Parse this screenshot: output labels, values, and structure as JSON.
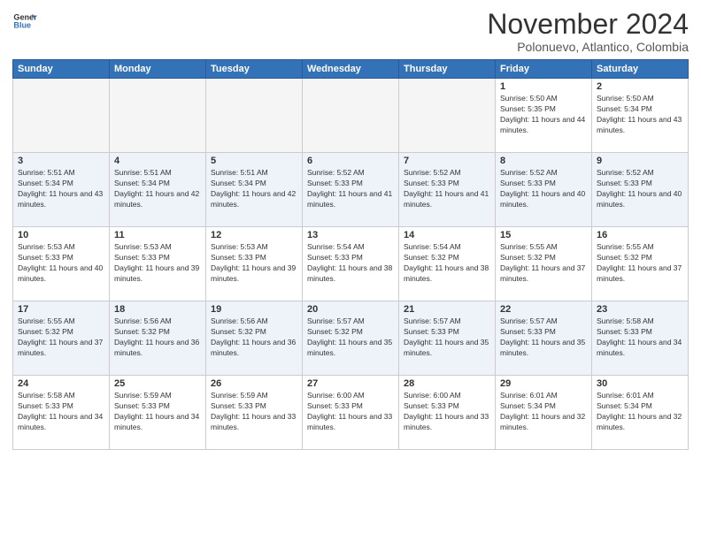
{
  "header": {
    "logo_line1": "General",
    "logo_line2": "Blue",
    "month_title": "November 2024",
    "location": "Polonuevo, Atlantico, Colombia"
  },
  "weekdays": [
    "Sunday",
    "Monday",
    "Tuesday",
    "Wednesday",
    "Thursday",
    "Friday",
    "Saturday"
  ],
  "weeks": [
    [
      {
        "day": "",
        "empty": true
      },
      {
        "day": "",
        "empty": true
      },
      {
        "day": "",
        "empty": true
      },
      {
        "day": "",
        "empty": true
      },
      {
        "day": "",
        "empty": true
      },
      {
        "day": "1",
        "sunrise": "5:50 AM",
        "sunset": "5:35 PM",
        "daylight": "11 hours and 44 minutes."
      },
      {
        "day": "2",
        "sunrise": "5:50 AM",
        "sunset": "5:34 PM",
        "daylight": "11 hours and 43 minutes."
      }
    ],
    [
      {
        "day": "3",
        "sunrise": "5:51 AM",
        "sunset": "5:34 PM",
        "daylight": "11 hours and 43 minutes."
      },
      {
        "day": "4",
        "sunrise": "5:51 AM",
        "sunset": "5:34 PM",
        "daylight": "11 hours and 42 minutes."
      },
      {
        "day": "5",
        "sunrise": "5:51 AM",
        "sunset": "5:34 PM",
        "daylight": "11 hours and 42 minutes."
      },
      {
        "day": "6",
        "sunrise": "5:52 AM",
        "sunset": "5:33 PM",
        "daylight": "11 hours and 41 minutes."
      },
      {
        "day": "7",
        "sunrise": "5:52 AM",
        "sunset": "5:33 PM",
        "daylight": "11 hours and 41 minutes."
      },
      {
        "day": "8",
        "sunrise": "5:52 AM",
        "sunset": "5:33 PM",
        "daylight": "11 hours and 40 minutes."
      },
      {
        "day": "9",
        "sunrise": "5:52 AM",
        "sunset": "5:33 PM",
        "daylight": "11 hours and 40 minutes."
      }
    ],
    [
      {
        "day": "10",
        "sunrise": "5:53 AM",
        "sunset": "5:33 PM",
        "daylight": "11 hours and 40 minutes."
      },
      {
        "day": "11",
        "sunrise": "5:53 AM",
        "sunset": "5:33 PM",
        "daylight": "11 hours and 39 minutes."
      },
      {
        "day": "12",
        "sunrise": "5:53 AM",
        "sunset": "5:33 PM",
        "daylight": "11 hours and 39 minutes."
      },
      {
        "day": "13",
        "sunrise": "5:54 AM",
        "sunset": "5:33 PM",
        "daylight": "11 hours and 38 minutes."
      },
      {
        "day": "14",
        "sunrise": "5:54 AM",
        "sunset": "5:32 PM",
        "daylight": "11 hours and 38 minutes."
      },
      {
        "day": "15",
        "sunrise": "5:55 AM",
        "sunset": "5:32 PM",
        "daylight": "11 hours and 37 minutes."
      },
      {
        "day": "16",
        "sunrise": "5:55 AM",
        "sunset": "5:32 PM",
        "daylight": "11 hours and 37 minutes."
      }
    ],
    [
      {
        "day": "17",
        "sunrise": "5:55 AM",
        "sunset": "5:32 PM",
        "daylight": "11 hours and 37 minutes."
      },
      {
        "day": "18",
        "sunrise": "5:56 AM",
        "sunset": "5:32 PM",
        "daylight": "11 hours and 36 minutes."
      },
      {
        "day": "19",
        "sunrise": "5:56 AM",
        "sunset": "5:32 PM",
        "daylight": "11 hours and 36 minutes."
      },
      {
        "day": "20",
        "sunrise": "5:57 AM",
        "sunset": "5:32 PM",
        "daylight": "11 hours and 35 minutes."
      },
      {
        "day": "21",
        "sunrise": "5:57 AM",
        "sunset": "5:33 PM",
        "daylight": "11 hours and 35 minutes."
      },
      {
        "day": "22",
        "sunrise": "5:57 AM",
        "sunset": "5:33 PM",
        "daylight": "11 hours and 35 minutes."
      },
      {
        "day": "23",
        "sunrise": "5:58 AM",
        "sunset": "5:33 PM",
        "daylight": "11 hours and 34 minutes."
      }
    ],
    [
      {
        "day": "24",
        "sunrise": "5:58 AM",
        "sunset": "5:33 PM",
        "daylight": "11 hours and 34 minutes."
      },
      {
        "day": "25",
        "sunrise": "5:59 AM",
        "sunset": "5:33 PM",
        "daylight": "11 hours and 34 minutes."
      },
      {
        "day": "26",
        "sunrise": "5:59 AM",
        "sunset": "5:33 PM",
        "daylight": "11 hours and 33 minutes."
      },
      {
        "day": "27",
        "sunrise": "6:00 AM",
        "sunset": "5:33 PM",
        "daylight": "11 hours and 33 minutes."
      },
      {
        "day": "28",
        "sunrise": "6:00 AM",
        "sunset": "5:33 PM",
        "daylight": "11 hours and 33 minutes."
      },
      {
        "day": "29",
        "sunrise": "6:01 AM",
        "sunset": "5:34 PM",
        "daylight": "11 hours and 32 minutes."
      },
      {
        "day": "30",
        "sunrise": "6:01 AM",
        "sunset": "5:34 PM",
        "daylight": "11 hours and 32 minutes."
      }
    ]
  ]
}
